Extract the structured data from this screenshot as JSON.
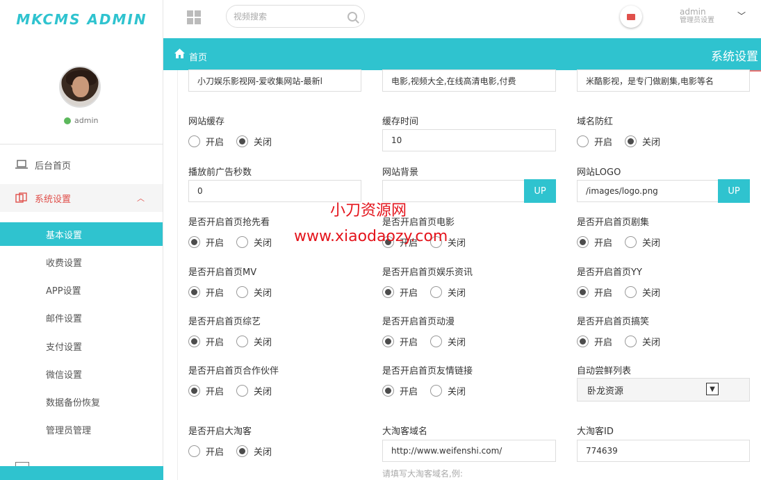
{
  "brand": {
    "logo": "MKCMS ADMIN"
  },
  "user": {
    "avatar_name": "admin",
    "status": "admin",
    "name": "admin",
    "role": "管理员设置"
  },
  "search": {
    "placeholder": "视频搜索"
  },
  "sidebar": {
    "home": "后台首页",
    "settings": "系统设置",
    "subitems": [
      "基本设置",
      "收费设置",
      "APP设置",
      "邮件设置",
      "支付设置",
      "微信设置",
      "数据备份恢复",
      "管理员管理"
    ]
  },
  "header": {
    "home": "首页",
    "title": "系统设置"
  },
  "form": {
    "top_inputs": [
      "小刀娱乐影视网-爱收集网站-最新l",
      "电影,视频大全,在线高清电影,付费",
      "米酷影视，是专门做剧集,电影等名"
    ],
    "cache": {
      "label": "网站缓存",
      "on": "开启",
      "off": "关闭"
    },
    "cache_time": {
      "label": "缓存时间",
      "value": "10"
    },
    "anti_red": {
      "label": "域名防红",
      "on": "开启",
      "off": "关闭"
    },
    "ad_seconds": {
      "label": "播放前广告秒数",
      "value": "0"
    },
    "background": {
      "label": "网站背景",
      "value": "",
      "button": "UP"
    },
    "logo": {
      "label": "网站LOGO",
      "value": "/images/logo.png",
      "button": "UP"
    },
    "radios": [
      {
        "label": "是否开启首页抢先看",
        "on": "开启",
        "off": "关闭",
        "selected": "on"
      },
      {
        "label": "是否开启首页电影",
        "on": "开启",
        "off": "关闭",
        "selected": "on"
      },
      {
        "label": "是否开启首页剧集",
        "on": "开启",
        "off": "关闭",
        "selected": "on"
      },
      {
        "label": "是否开启首页MV",
        "on": "开启",
        "off": "关闭",
        "selected": "on"
      },
      {
        "label": "是否开启首页娱乐资讯",
        "on": "开启",
        "off": "关闭",
        "selected": "on"
      },
      {
        "label": "是否开启首页YY",
        "on": "开启",
        "off": "关闭",
        "selected": "on"
      },
      {
        "label": "是否开启首页综艺",
        "on": "开启",
        "off": "关闭",
        "selected": "on"
      },
      {
        "label": "是否开启首页动漫",
        "on": "开启",
        "off": "关闭",
        "selected": "on"
      },
      {
        "label": "是否开启首页搞笑",
        "on": "开启",
        "off": "关闭",
        "selected": "on"
      },
      {
        "label": "是否开启首页合作伙伴",
        "on": "开启",
        "off": "关闭",
        "selected": "on"
      },
      {
        "label": "是否开启首页友情链接",
        "on": "开启",
        "off": "关闭",
        "selected": "on"
      }
    ],
    "collect": {
      "label": "自动尝鲜列表",
      "value": "卧龙资源"
    },
    "taoke": {
      "label": "是否开启大淘客",
      "on": "开启",
      "off": "关闭"
    },
    "taoke_domain": {
      "label": "大淘客域名",
      "value": "http://www.weifenshi.com/",
      "hint": "请填写大淘客域名,例:"
    },
    "taoke_id": {
      "label": "大淘客ID",
      "value": "774639"
    }
  },
  "watermark": {
    "line1": "小刀资源网",
    "line2": "www.xiaodaozy.com"
  },
  "colors": {
    "accent": "#2fc3cf",
    "active_nav": "#e0504b",
    "watermark": "#e4141c"
  }
}
